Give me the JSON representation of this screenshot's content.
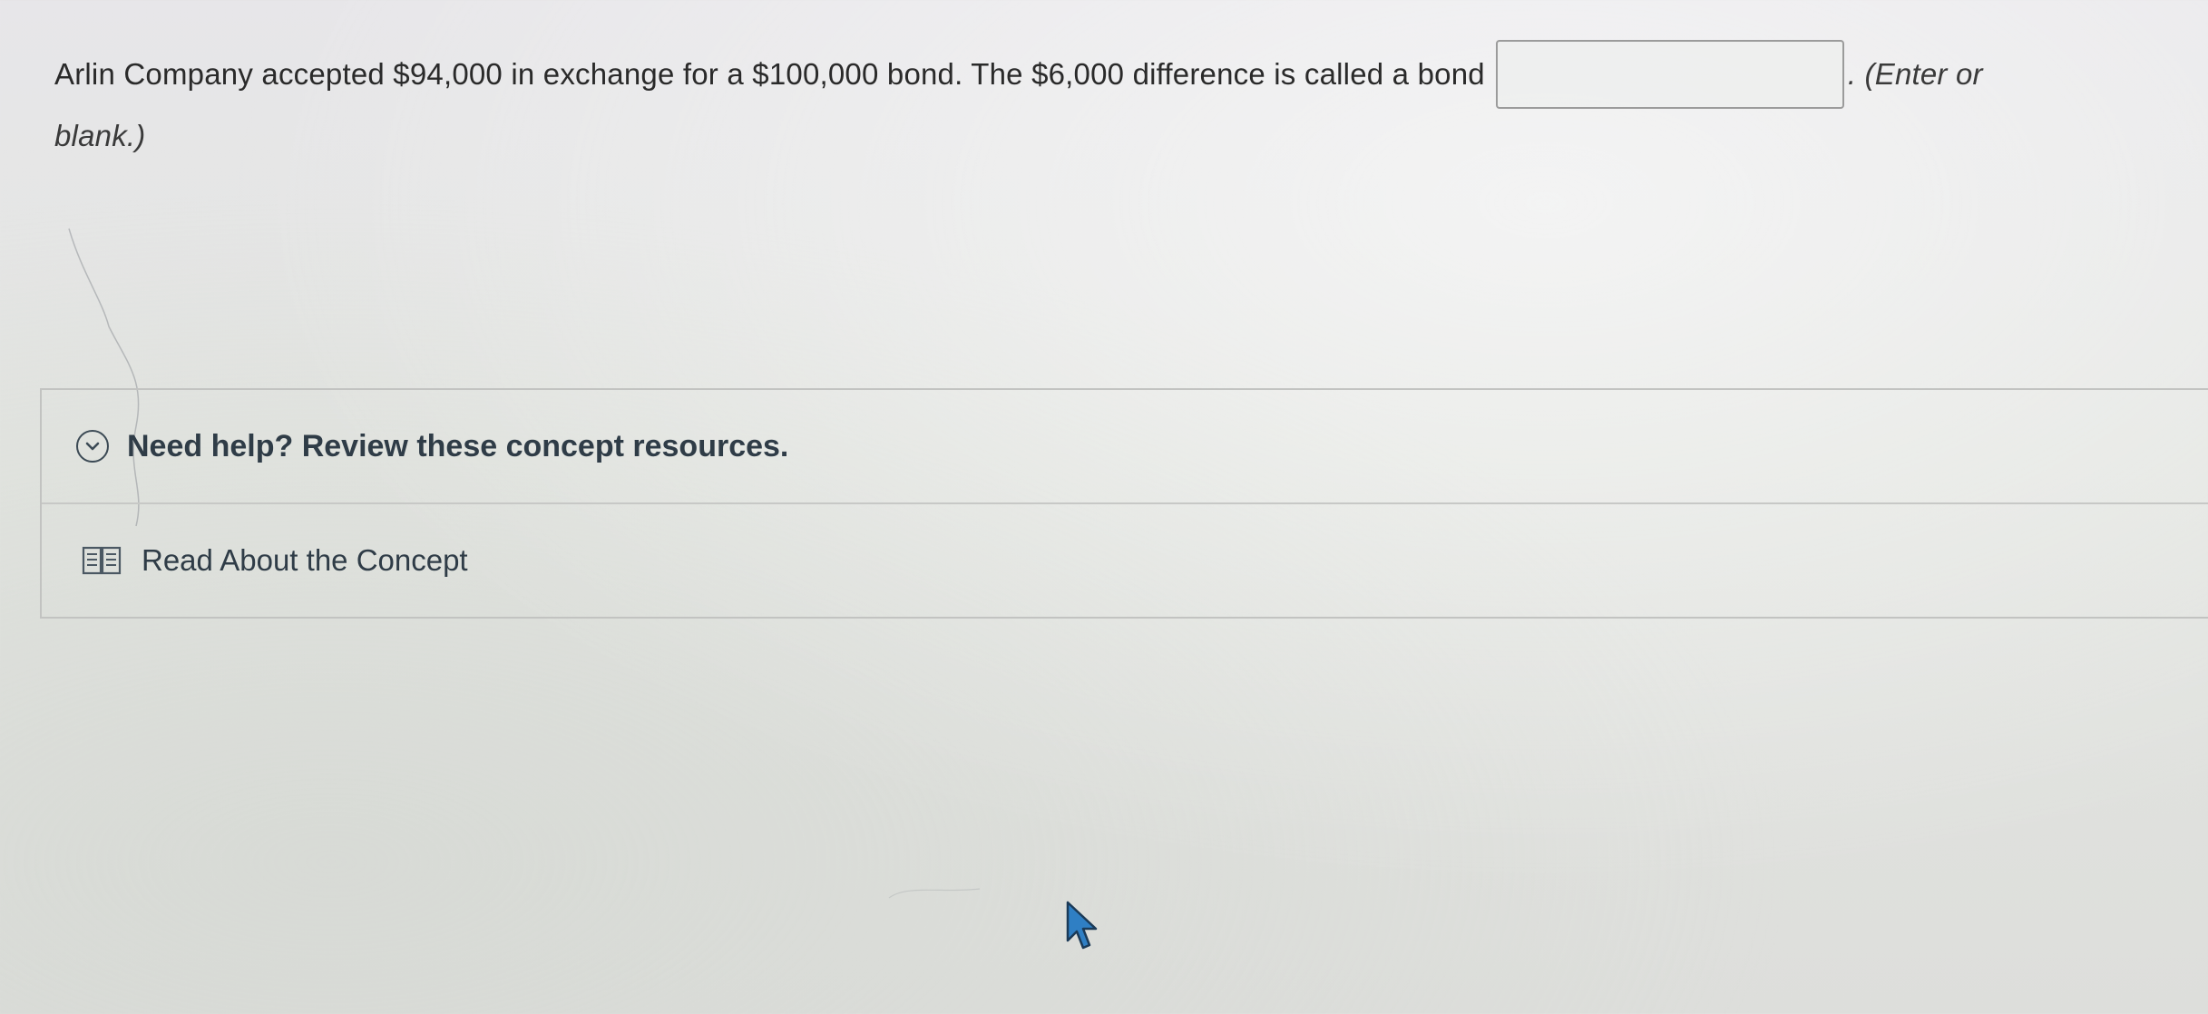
{
  "question": {
    "text_before_box": "Arlin Company accepted $94,000 in exchange for a $100,000 bond. The $6,000 difference is called a bond",
    "answer_value": "",
    "text_after_box": ". (Enter or",
    "text_line2": "blank.)"
  },
  "help": {
    "title": "Need help? Review these concept resources.",
    "expand_icon": "chevron-down-circle-icon",
    "resources": [
      {
        "label": "Read About the Concept",
        "icon": "book-icon"
      }
    ]
  },
  "colors": {
    "heading": "#2f3c47",
    "border": "#c2c3c1"
  }
}
